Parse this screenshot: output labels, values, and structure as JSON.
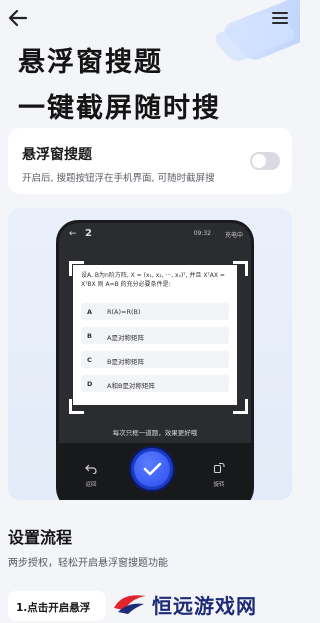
{
  "header": {
    "back_icon": "arrow-left-icon",
    "menu_icon": "hamburger-menu-icon",
    "title_line1": "悬浮窗搜题",
    "title_line2": "一键截屏随时搜"
  },
  "toggle_card": {
    "title": "悬浮窗搜题",
    "description": "开启后, 搜题按钮浮在手机界面, 可随时截屏搜",
    "toggle_on": false
  },
  "demo": {
    "statusbar": {
      "back": "←",
      "num": "2",
      "time": "09:32",
      "battery": "充电中"
    },
    "question": "设A, B为n阶方阵, X = (x₁, x₂, ···, xₙ)ᵀ, 并且 XᵀAX = XᵀBX 则 A=B 的充分必要条件是:",
    "options": [
      {
        "key": "A",
        "value": "R(A)=R(B)"
      },
      {
        "key": "B",
        "value": "A是对称矩阵"
      },
      {
        "key": "C",
        "value": "B是对称矩阵"
      },
      {
        "key": "D",
        "value": "A和B是对称矩阵"
      }
    ],
    "hint": "每次只框一道题，效果更好哦",
    "left_button": "返回",
    "right_button": "旋转"
  },
  "setup": {
    "title": "设置流程",
    "description": "两步授权，轻松开启悬浮窗搜题功能",
    "step1": "1.点击开启悬浮"
  },
  "watermark": {
    "text": "恒远游戏网"
  },
  "colors": {
    "accent": "#2c4ef0",
    "background": "#f3f5f8",
    "watermark": "#1d2b78"
  }
}
